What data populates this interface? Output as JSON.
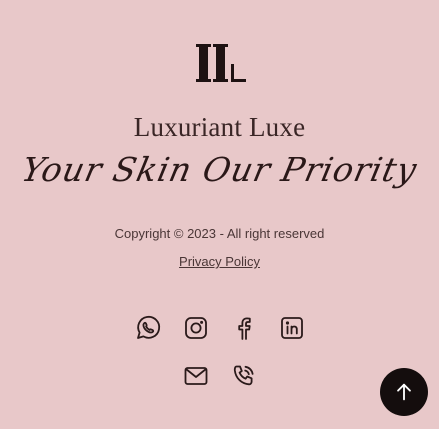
{
  "footer": {
    "logo": {
      "icon": "ll-monogram-logo"
    },
    "brand_name": "Luxuriant Luxe",
    "tagline": "Your Skin Our Priority",
    "copyright": "Copyright © 2023 - All right reserved",
    "privacy_link": "Privacy Policy",
    "social_icons": [
      "whatsapp-icon",
      "instagram-icon",
      "facebook-icon",
      "linkedin-icon"
    ],
    "contact_icons": [
      "mail-icon",
      "phone-icon"
    ],
    "scroll_top": {
      "icon": "arrow-up-icon"
    }
  },
  "colors": {
    "background": "#e8c8c9",
    "text": "#2a1a1a",
    "button": "#140d0d"
  }
}
